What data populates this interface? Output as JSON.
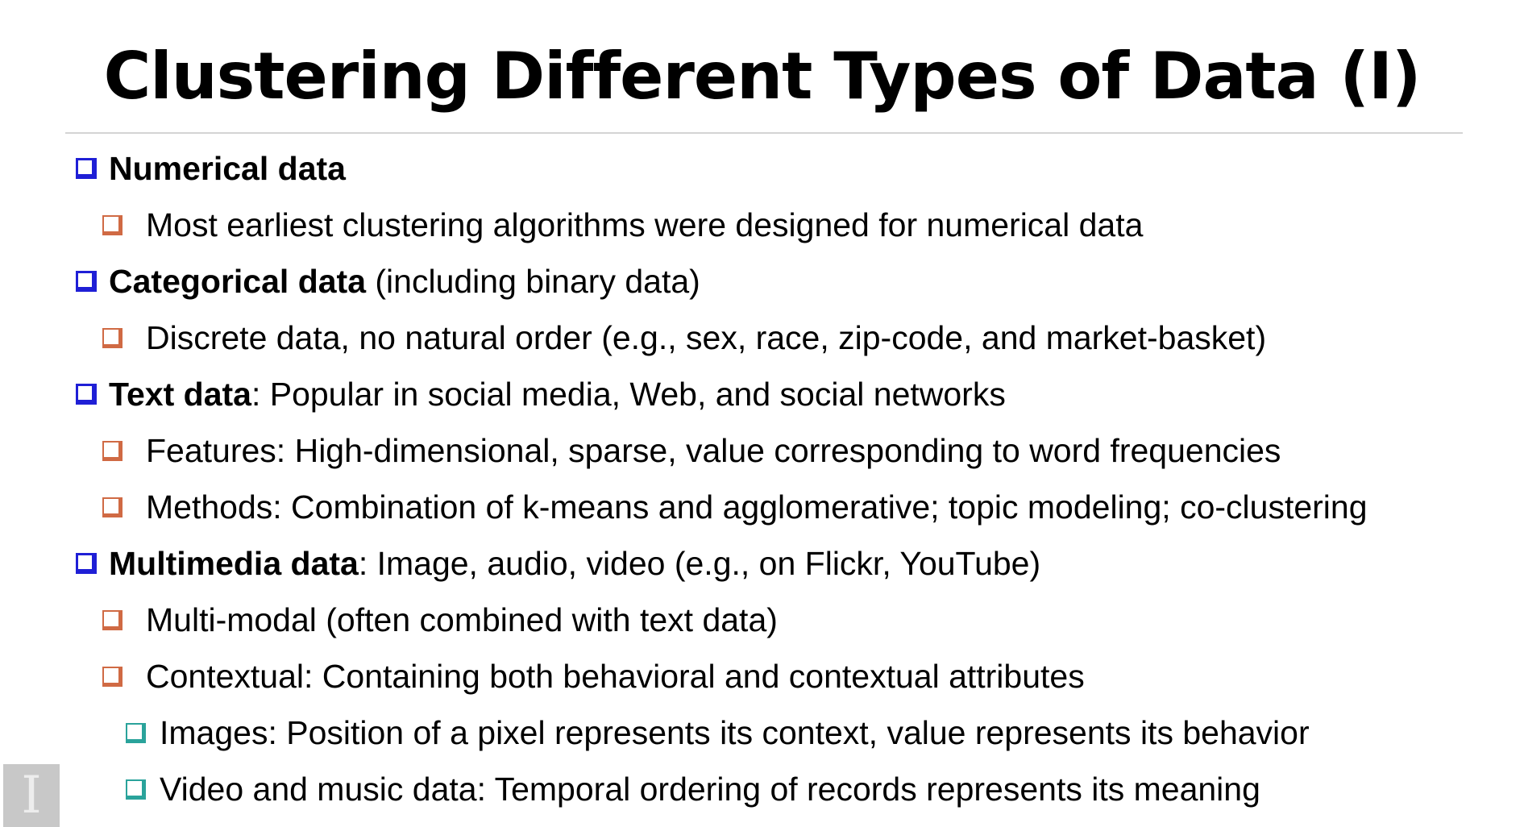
{
  "slide": {
    "title": "Clustering Different Types of Data (I)",
    "items": [
      {
        "level": 1,
        "bold": "Numerical data",
        "rest": ""
      },
      {
        "level": 2,
        "bold": "",
        "rest": "Most earliest clustering algorithms were designed for numerical data"
      },
      {
        "level": 1,
        "bold": "Categorical data",
        "rest": " (including binary data)"
      },
      {
        "level": 2,
        "bold": "",
        "rest": "Discrete data, no natural order (e.g., sex, race, zip-code, and market-basket)"
      },
      {
        "level": 1,
        "bold": "Text data",
        "rest": ":  Popular in social media, Web, and social networks"
      },
      {
        "level": 2,
        "bold": "",
        "rest": "Features:  High-dimensional, sparse, value corresponding to word frequencies"
      },
      {
        "level": 2,
        "bold": "",
        "rest": "Methods: Combination of k-means and agglomerative; topic modeling; co-clustering"
      },
      {
        "level": 1,
        "bold": "Multimedia data",
        "rest": ": Image, audio, video (e.g., on Flickr, YouTube)"
      },
      {
        "level": 2,
        "bold": "",
        "rest": "Multi-modal (often combined with text data)"
      },
      {
        "level": 2,
        "bold": "",
        "rest": "Contextual: Containing both behavioral and contextual attributes"
      },
      {
        "level": 3,
        "bold": "",
        "rest": "Images:  Position of a pixel represents its context, value represents its behavior"
      },
      {
        "level": 3,
        "bold": "",
        "rest": "Video and music data:  Temporal ordering of records represents its meaning"
      }
    ]
  },
  "colors": {
    "level1_bullet": "#1f1fd6",
    "level2_bullet": "#d06a44",
    "level3_bullet": "#2aa39b"
  },
  "overlay": {
    "icon": "text-cursor-icon",
    "glyph": "I"
  }
}
